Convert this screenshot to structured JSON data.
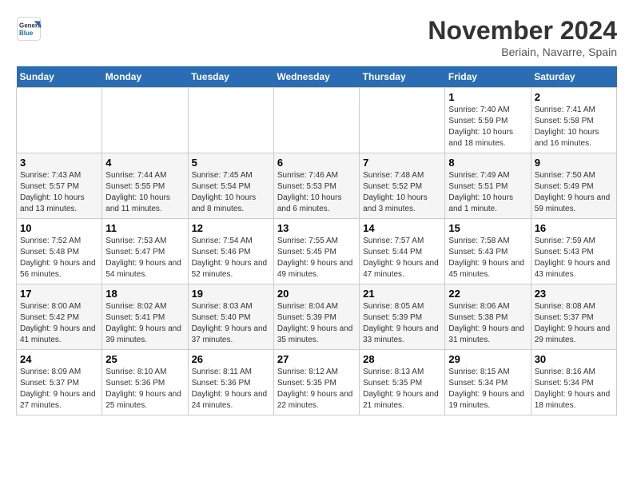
{
  "header": {
    "logo_general": "General",
    "logo_blue": "Blue",
    "month_title": "November 2024",
    "location": "Beriain, Navarre, Spain"
  },
  "weekdays": [
    "Sunday",
    "Monday",
    "Tuesday",
    "Wednesday",
    "Thursday",
    "Friday",
    "Saturday"
  ],
  "weeks": [
    [
      {
        "day": "",
        "info": ""
      },
      {
        "day": "",
        "info": ""
      },
      {
        "day": "",
        "info": ""
      },
      {
        "day": "",
        "info": ""
      },
      {
        "day": "",
        "info": ""
      },
      {
        "day": "1",
        "info": "Sunrise: 7:40 AM\nSunset: 5:59 PM\nDaylight: 10 hours and 18 minutes."
      },
      {
        "day": "2",
        "info": "Sunrise: 7:41 AM\nSunset: 5:58 PM\nDaylight: 10 hours and 16 minutes."
      }
    ],
    [
      {
        "day": "3",
        "info": "Sunrise: 7:43 AM\nSunset: 5:57 PM\nDaylight: 10 hours and 13 minutes."
      },
      {
        "day": "4",
        "info": "Sunrise: 7:44 AM\nSunset: 5:55 PM\nDaylight: 10 hours and 11 minutes."
      },
      {
        "day": "5",
        "info": "Sunrise: 7:45 AM\nSunset: 5:54 PM\nDaylight: 10 hours and 8 minutes."
      },
      {
        "day": "6",
        "info": "Sunrise: 7:46 AM\nSunset: 5:53 PM\nDaylight: 10 hours and 6 minutes."
      },
      {
        "day": "7",
        "info": "Sunrise: 7:48 AM\nSunset: 5:52 PM\nDaylight: 10 hours and 3 minutes."
      },
      {
        "day": "8",
        "info": "Sunrise: 7:49 AM\nSunset: 5:51 PM\nDaylight: 10 hours and 1 minute."
      },
      {
        "day": "9",
        "info": "Sunrise: 7:50 AM\nSunset: 5:49 PM\nDaylight: 9 hours and 59 minutes."
      }
    ],
    [
      {
        "day": "10",
        "info": "Sunrise: 7:52 AM\nSunset: 5:48 PM\nDaylight: 9 hours and 56 minutes."
      },
      {
        "day": "11",
        "info": "Sunrise: 7:53 AM\nSunset: 5:47 PM\nDaylight: 9 hours and 54 minutes."
      },
      {
        "day": "12",
        "info": "Sunrise: 7:54 AM\nSunset: 5:46 PM\nDaylight: 9 hours and 52 minutes."
      },
      {
        "day": "13",
        "info": "Sunrise: 7:55 AM\nSunset: 5:45 PM\nDaylight: 9 hours and 49 minutes."
      },
      {
        "day": "14",
        "info": "Sunrise: 7:57 AM\nSunset: 5:44 PM\nDaylight: 9 hours and 47 minutes."
      },
      {
        "day": "15",
        "info": "Sunrise: 7:58 AM\nSunset: 5:43 PM\nDaylight: 9 hours and 45 minutes."
      },
      {
        "day": "16",
        "info": "Sunrise: 7:59 AM\nSunset: 5:43 PM\nDaylight: 9 hours and 43 minutes."
      }
    ],
    [
      {
        "day": "17",
        "info": "Sunrise: 8:00 AM\nSunset: 5:42 PM\nDaylight: 9 hours and 41 minutes."
      },
      {
        "day": "18",
        "info": "Sunrise: 8:02 AM\nSunset: 5:41 PM\nDaylight: 9 hours and 39 minutes."
      },
      {
        "day": "19",
        "info": "Sunrise: 8:03 AM\nSunset: 5:40 PM\nDaylight: 9 hours and 37 minutes."
      },
      {
        "day": "20",
        "info": "Sunrise: 8:04 AM\nSunset: 5:39 PM\nDaylight: 9 hours and 35 minutes."
      },
      {
        "day": "21",
        "info": "Sunrise: 8:05 AM\nSunset: 5:39 PM\nDaylight: 9 hours and 33 minutes."
      },
      {
        "day": "22",
        "info": "Sunrise: 8:06 AM\nSunset: 5:38 PM\nDaylight: 9 hours and 31 minutes."
      },
      {
        "day": "23",
        "info": "Sunrise: 8:08 AM\nSunset: 5:37 PM\nDaylight: 9 hours and 29 minutes."
      }
    ],
    [
      {
        "day": "24",
        "info": "Sunrise: 8:09 AM\nSunset: 5:37 PM\nDaylight: 9 hours and 27 minutes."
      },
      {
        "day": "25",
        "info": "Sunrise: 8:10 AM\nSunset: 5:36 PM\nDaylight: 9 hours and 25 minutes."
      },
      {
        "day": "26",
        "info": "Sunrise: 8:11 AM\nSunset: 5:36 PM\nDaylight: 9 hours and 24 minutes."
      },
      {
        "day": "27",
        "info": "Sunrise: 8:12 AM\nSunset: 5:35 PM\nDaylight: 9 hours and 22 minutes."
      },
      {
        "day": "28",
        "info": "Sunrise: 8:13 AM\nSunset: 5:35 PM\nDaylight: 9 hours and 21 minutes."
      },
      {
        "day": "29",
        "info": "Sunrise: 8:15 AM\nSunset: 5:34 PM\nDaylight: 9 hours and 19 minutes."
      },
      {
        "day": "30",
        "info": "Sunrise: 8:16 AM\nSunset: 5:34 PM\nDaylight: 9 hours and 18 minutes."
      }
    ]
  ]
}
